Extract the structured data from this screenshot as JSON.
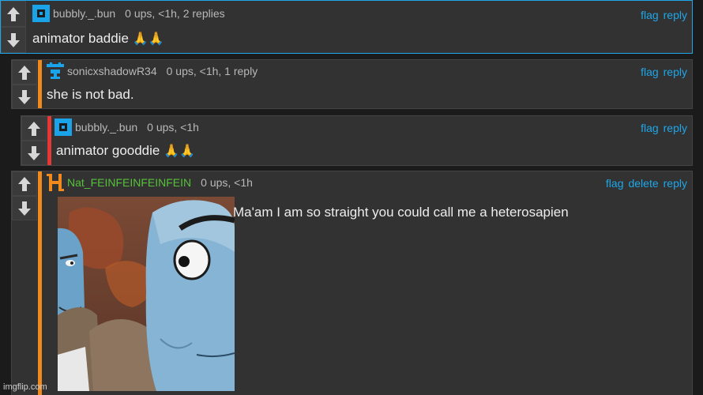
{
  "comments": [
    {
      "username": "bubbly._.bun",
      "meta": "0 ups, <1h, 2 replies",
      "text": "animator baddie",
      "emoji": "🙏🙏",
      "actions": [
        "flag",
        "reply"
      ]
    },
    {
      "username": "sonicxshadowR34",
      "meta": "0 ups, <1h, 1 reply",
      "text": "she is not bad.",
      "actions": [
        "flag",
        "reply"
      ]
    },
    {
      "username": "bubbly._.bun",
      "meta": "0 ups, <1h",
      "text": "animator gooddie",
      "emoji": "🙏🙏",
      "actions": [
        "flag",
        "reply"
      ]
    },
    {
      "username": "Nat_FEINFEINFEINFEIN",
      "meta": "0 ups, <1h",
      "text": "Ma'am I am so straight you could call me a heterosapien",
      "actions": [
        "flag",
        "delete",
        "reply"
      ]
    }
  ],
  "watermark": "imgflip.com",
  "colors": {
    "accent_link": "#1ea7ea",
    "stripe_orange": "#f08a1c",
    "stripe_red": "#e53935",
    "avatar_blue": "#1aa3e8",
    "username_green": "#56c23a"
  },
  "icons": [
    "upvote-arrow-icon",
    "downvote-arrow-icon",
    "avatar-icon"
  ]
}
